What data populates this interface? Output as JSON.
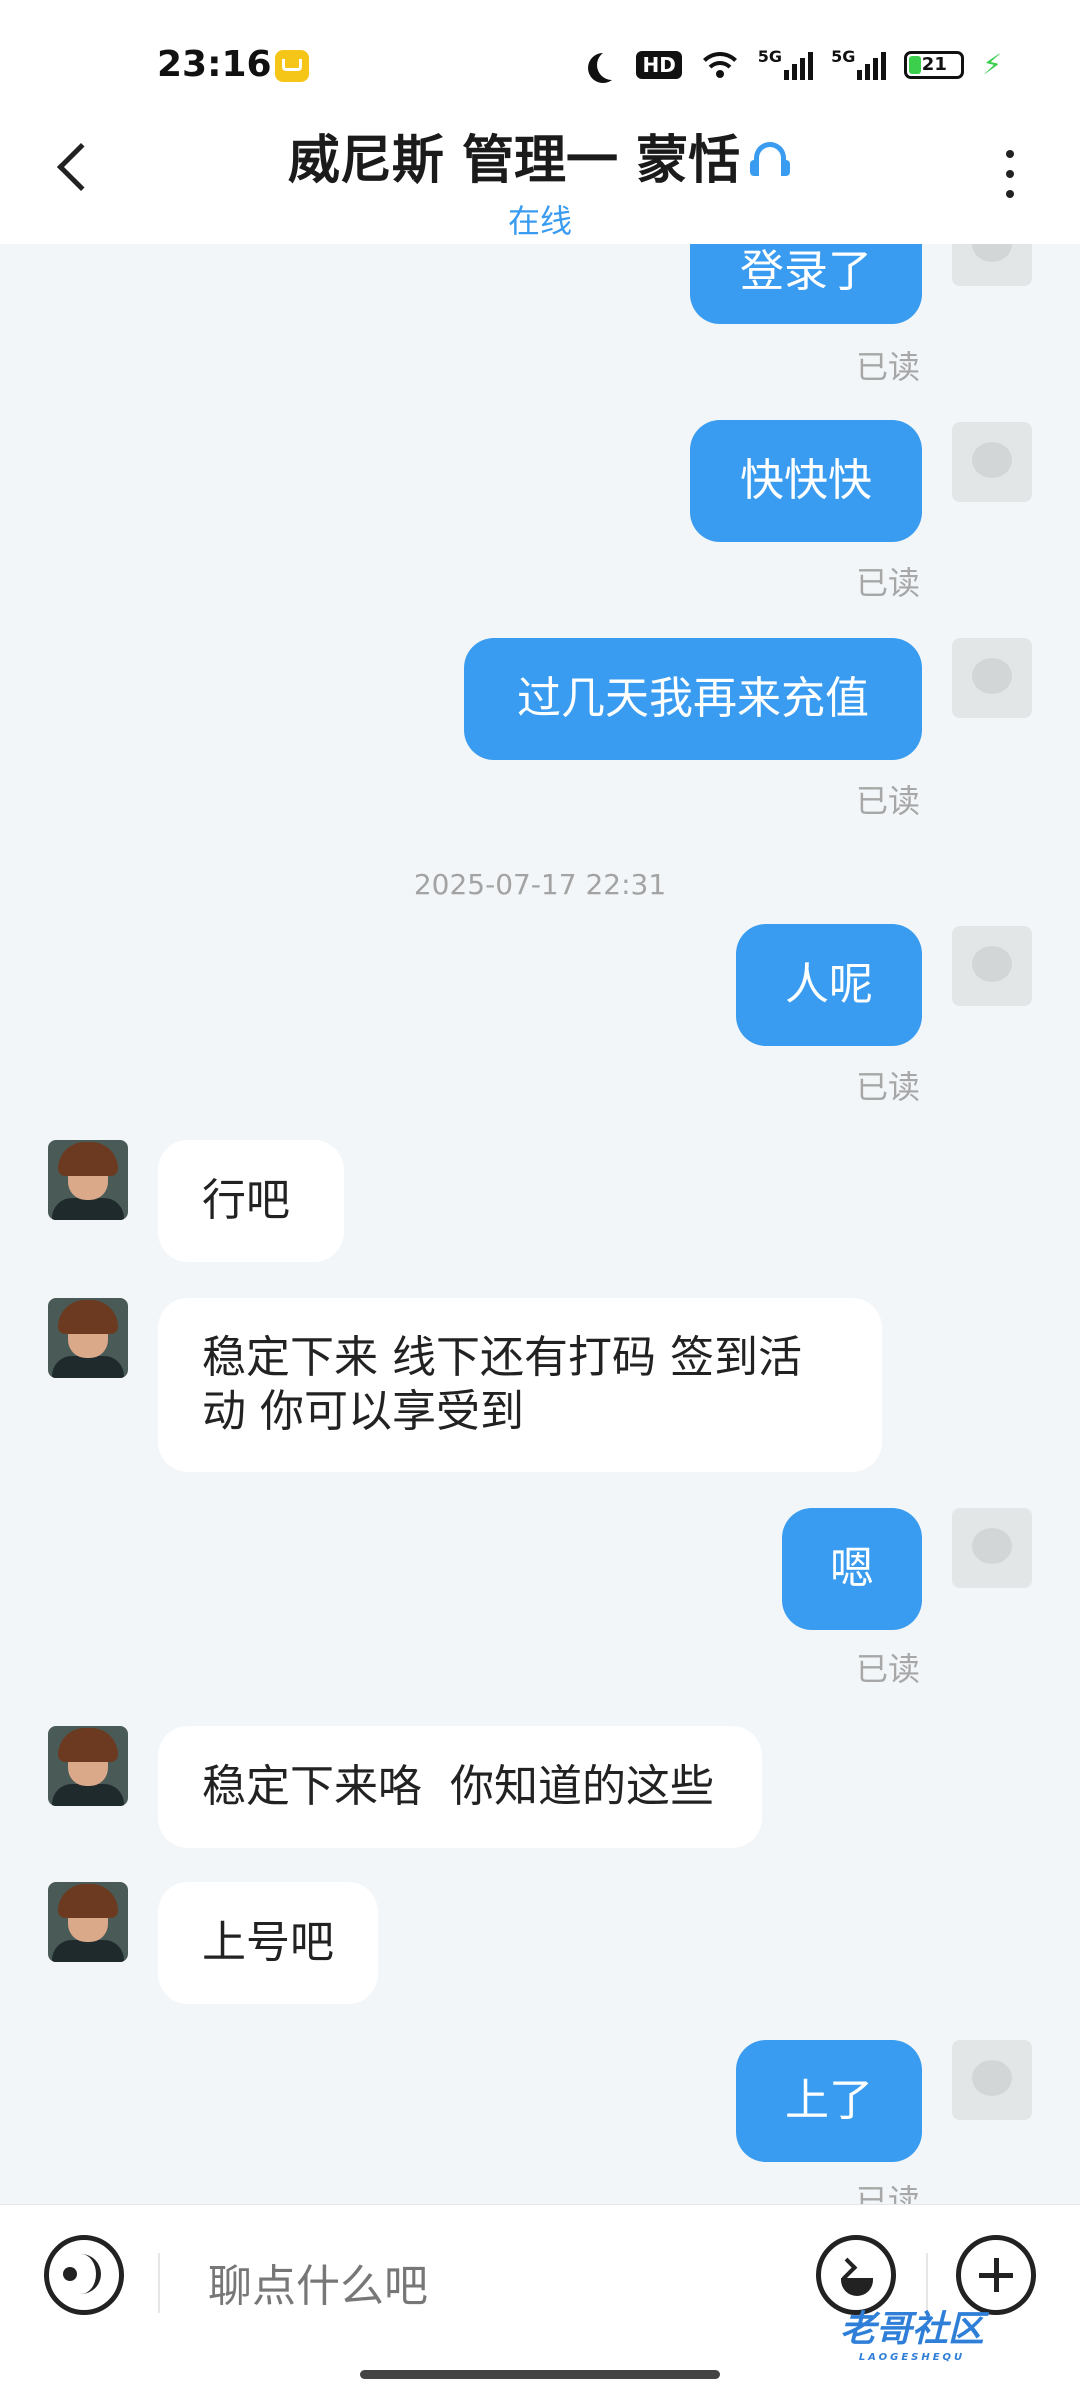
{
  "status_bar": {
    "time": "23:16",
    "hd_label": "HD",
    "network_1": "5G",
    "network_2": "5G",
    "battery": "21"
  },
  "header": {
    "title": "威尼斯 管理一 蒙恬",
    "status": "在线"
  },
  "messages": {
    "m1": {
      "text": "登录了",
      "read": "已读"
    },
    "m2": {
      "text": "快快快",
      "read": "已读"
    },
    "m3": {
      "text": "过几天我再来充值",
      "read": "已读"
    },
    "timestamp": "2025-07-17 22:31",
    "m4": {
      "text": "人呢",
      "read": "已读"
    },
    "r1": {
      "text": "行吧"
    },
    "r2": {
      "text": "稳定下来 线下还有打码 签到活动 你可以享受到"
    },
    "m5": {
      "text": "嗯",
      "read": "已读"
    },
    "r3": {
      "text": "稳定下来咯  你知道的这些"
    },
    "r4": {
      "text": "上号吧"
    },
    "m6": {
      "text": "上了",
      "read": "已读"
    }
  },
  "input": {
    "placeholder": "聊点什么吧"
  },
  "watermark": {
    "text": "老哥社区",
    "sub": "LAOGESHEQU"
  },
  "colors": {
    "accent": "#3a9cf0",
    "background": "#f2f6f8",
    "my_bubble": "#3a9cf0",
    "their_bubble": "#ffffff"
  }
}
